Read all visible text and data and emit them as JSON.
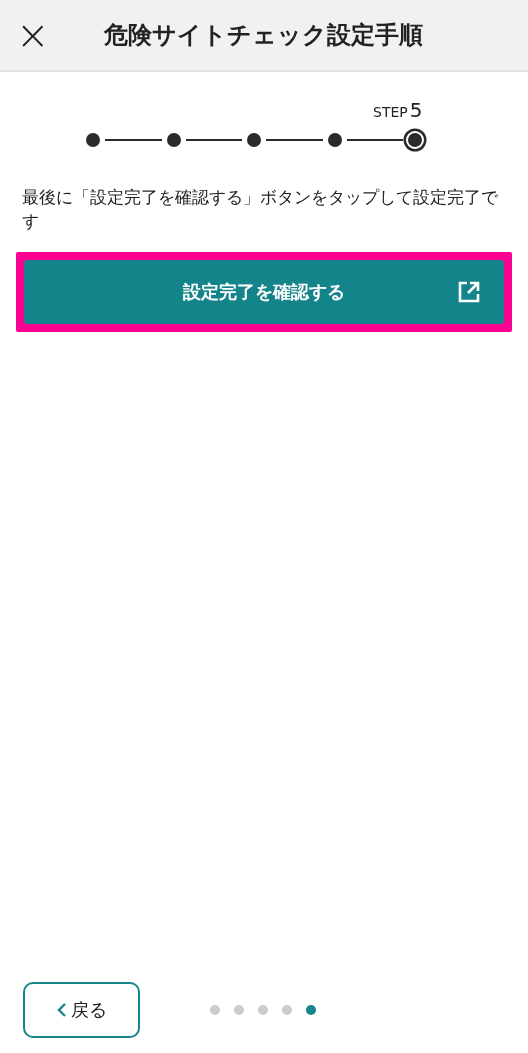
{
  "header": {
    "close": "×",
    "title": "危険サイトチェック設定手順"
  },
  "stepper": {
    "label": "STEP",
    "number": "5",
    "steps": [
      {
        "selected": false
      },
      {
        "selected": false
      },
      {
        "selected": false
      },
      {
        "selected": false
      },
      {
        "selected": true
      }
    ]
  },
  "instruction": "最後に「設定完了を確認する」ボタンをタップして設定完了です",
  "action_button": {
    "label": "設定完了を確認する",
    "highlighted": true
  },
  "footer": {
    "back_button": "戻る",
    "pages": [
      {
        "selected": false
      },
      {
        "selected": false
      },
      {
        "selected": false
      },
      {
        "selected": false
      },
      {
        "selected": true
      }
    ]
  }
}
